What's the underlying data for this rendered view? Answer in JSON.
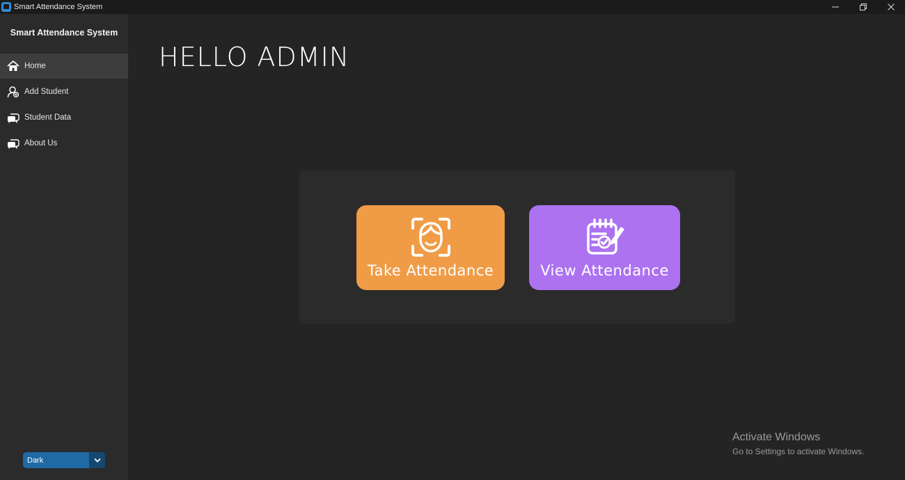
{
  "window": {
    "title": "Smart Attendance System"
  },
  "sidebar": {
    "brand": "Smart Attendance System",
    "items": [
      {
        "label": "Home",
        "icon": "home-icon",
        "active": true
      },
      {
        "label": "Add Student",
        "icon": "add-user-icon",
        "active": false
      },
      {
        "label": "Student Data",
        "icon": "chat-icon",
        "active": false
      },
      {
        "label": "About Us",
        "icon": "chat-icon",
        "active": false
      }
    ],
    "theme_select": {
      "value": "Dark"
    }
  },
  "main": {
    "greeting": "HELLO ADMIN",
    "actions": [
      {
        "label": "Take Attendance",
        "icon": "face-scan-icon",
        "color": "#f09c47"
      },
      {
        "label": "View Attendance",
        "icon": "clipboard-check-icon",
        "color": "#ac72f0"
      }
    ]
  },
  "watermark": {
    "title": "Activate Windows",
    "subtitle": "Go to Settings to activate Windows."
  },
  "colors": {
    "background": "#242424",
    "sidebar": "#2b2b2b",
    "accent": "#1f6aa5"
  }
}
